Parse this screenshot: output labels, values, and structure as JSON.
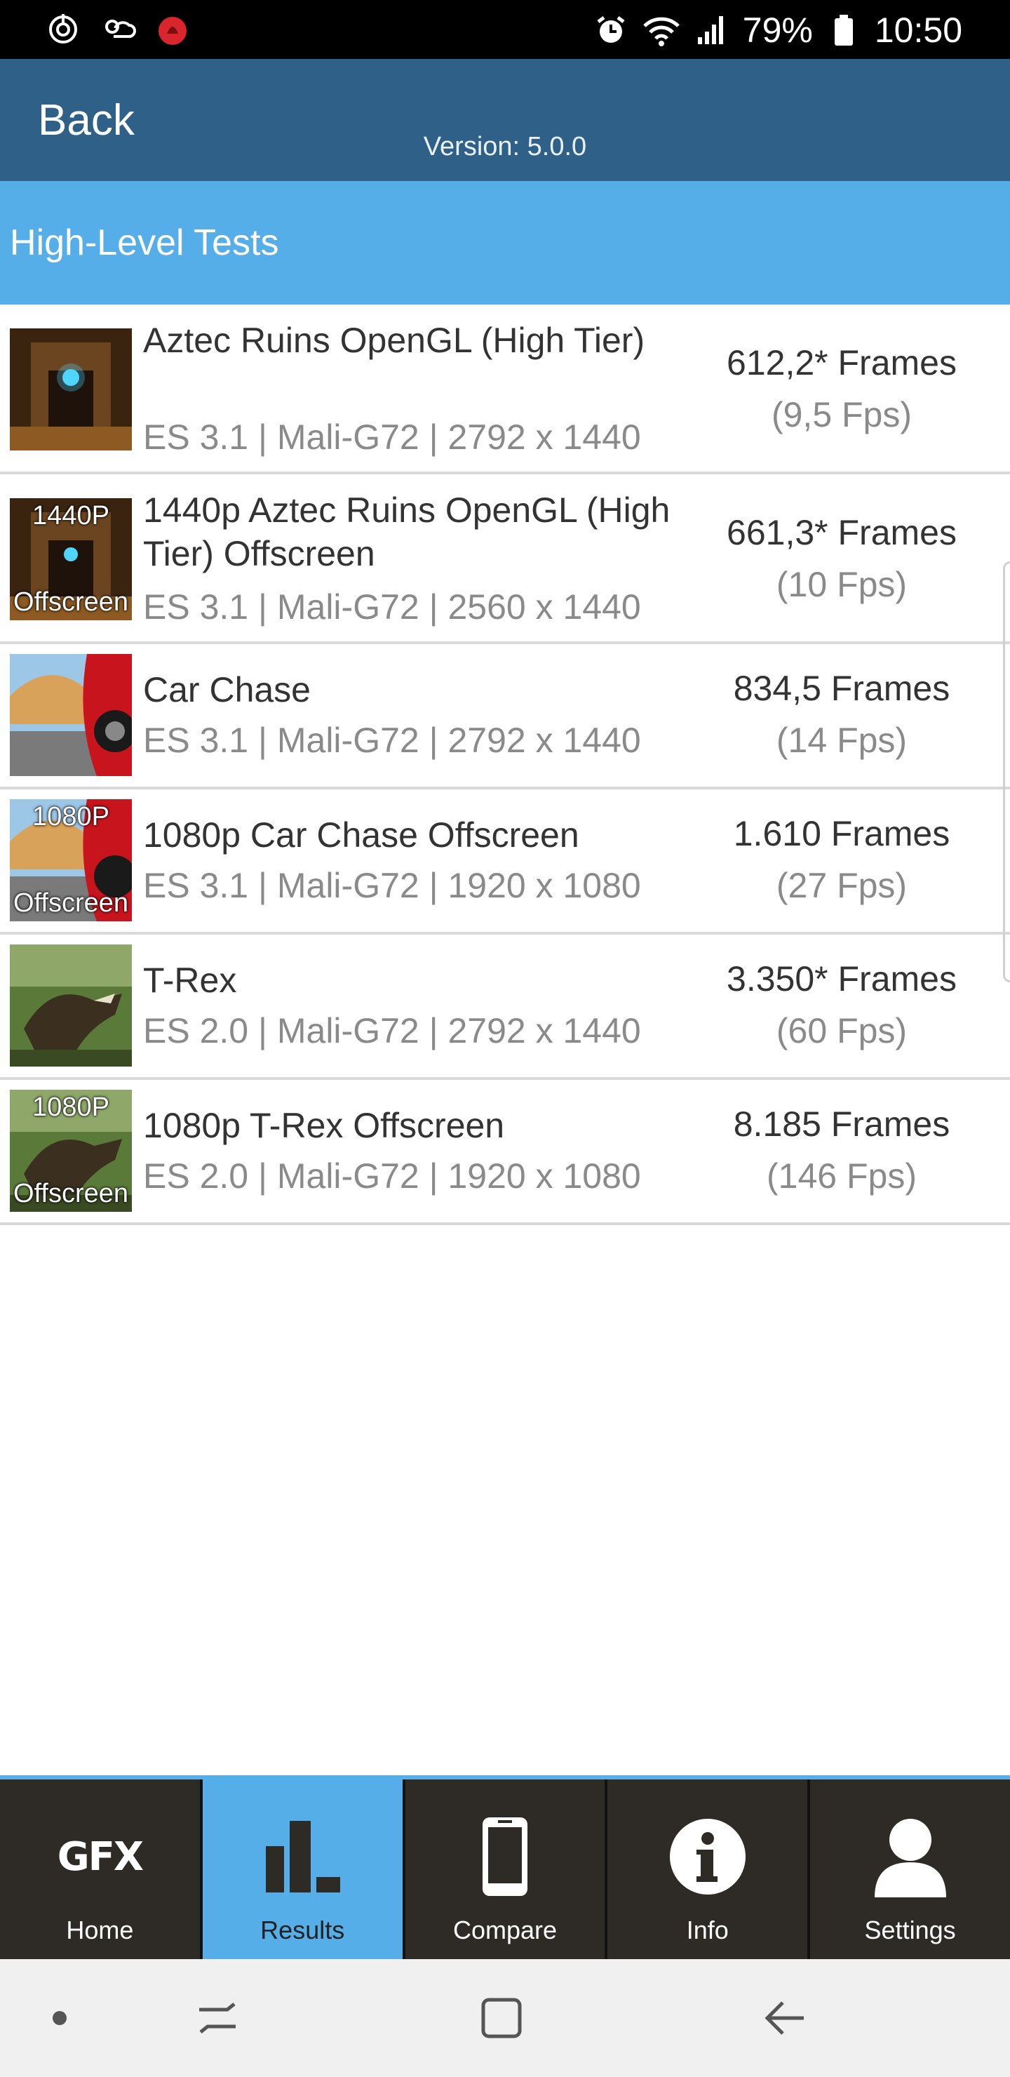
{
  "status_bar": {
    "battery": "79%",
    "time": "10:50",
    "icons": [
      "sync-icon",
      "weather-icon",
      "app-notification-icon",
      "alarm-icon",
      "wifi-icon",
      "signal-icon",
      "battery-icon"
    ]
  },
  "app_bar": {
    "back_label": "Back",
    "version": "Version: 5.0.0"
  },
  "section": {
    "title": "High-Level Tests"
  },
  "tests": [
    {
      "name": "Aztec Ruins OpenGL (High Tier)",
      "spec": "ES 3.1 | Mali-G72 | 2792 x 1440",
      "score": "612,2* Frames",
      "fps": "(9,5 Fps)",
      "thumb_tag": ""
    },
    {
      "name": "1440p Aztec Ruins OpenGL (High Tier) Offscreen",
      "spec": "ES 3.1 | Mali-G72 | 2560 x 1440",
      "score": "661,3* Frames",
      "fps": "(10 Fps)",
      "thumb_tag_top": "1440P",
      "thumb_tag_bottom": "Offscreen"
    },
    {
      "name": "Car Chase",
      "spec": "ES 3.1 | Mali-G72 | 2792 x 1440",
      "score": "834,5 Frames",
      "fps": "(14 Fps)"
    },
    {
      "name": "1080p Car Chase Offscreen",
      "spec": "ES 3.1 | Mali-G72 | 1920 x 1080",
      "score": "1.610 Frames",
      "fps": "(27 Fps)",
      "thumb_tag_top": "1080P",
      "thumb_tag_bottom": "Offscreen"
    },
    {
      "name": "T-Rex",
      "spec": "ES 2.0 | Mali-G72 | 2792 x 1440",
      "score": "3.350* Frames",
      "fps": "(60 Fps)"
    },
    {
      "name": "1080p T-Rex Offscreen",
      "spec": "ES 2.0 | Mali-G72 | 1920 x 1080",
      "score": "8.185 Frames",
      "fps": "(146 Fps)",
      "thumb_tag_top": "1080P",
      "thumb_tag_bottom": "Offscreen"
    }
  ],
  "tabs": [
    {
      "label": "Home",
      "logo": "GFX",
      "icon": "gfx-logo-icon"
    },
    {
      "label": "Results",
      "icon": "bar-chart-icon",
      "active": true
    },
    {
      "label": "Compare",
      "icon": "phone-icon"
    },
    {
      "label": "Info",
      "icon": "info-icon"
    },
    {
      "label": "Settings",
      "icon": "user-icon"
    }
  ],
  "colors": {
    "status_bar": "#000000",
    "app_bar": "#2f6087",
    "accent": "#56aee8",
    "tab_bar": "#2e2b26",
    "nav_bar": "#f0f0f0"
  }
}
